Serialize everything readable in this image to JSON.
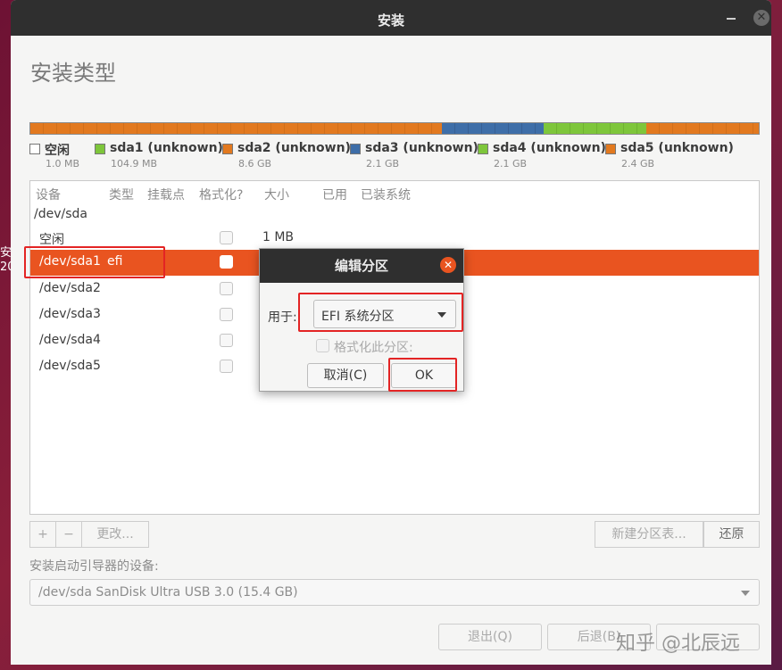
{
  "desktop": {
    "fragment_a": "安装",
    "fragment_b": "20"
  },
  "window": {
    "title": "安装"
  },
  "page": {
    "heading": "安装类型"
  },
  "partitions_bar": [
    {
      "name": "空闲",
      "size": "1.0 MB",
      "color": "#ffffff"
    },
    {
      "name": "sda1 (unknown)",
      "size": "104.9 MB",
      "color": "#7ec63b"
    },
    {
      "name": "sda2 (unknown)",
      "size": "8.6 GB",
      "color": "#e2791f"
    },
    {
      "name": "sda3 (unknown)",
      "size": "2.1 GB",
      "color": "#3e6ea8"
    },
    {
      "name": "sda4 (unknown)",
      "size": "2.1 GB",
      "color": "#7ec63b"
    },
    {
      "name": "sda5 (unknown)",
      "size": "2.4 GB",
      "color": "#e2791f"
    }
  ],
  "table": {
    "headers": [
      "设备",
      "类型",
      "挂载点",
      "格式化?",
      "大小",
      "已用",
      "已装系统"
    ],
    "rows": [
      {
        "device": "/dev/sda",
        "type": "",
        "size": ""
      },
      {
        "device": "空闲",
        "type": "",
        "size": "1 MB"
      },
      {
        "device": "/dev/sda1",
        "type": "efi",
        "size": ""
      },
      {
        "device": "/dev/sda2",
        "type": "",
        "size": ""
      },
      {
        "device": "/dev/sda3",
        "type": "",
        "size": ""
      },
      {
        "device": "/dev/sda4",
        "type": "",
        "size": ""
      },
      {
        "device": "/dev/sda5",
        "type": "",
        "size": ""
      }
    ]
  },
  "toolbar": {
    "add": "+",
    "remove": "−",
    "change": "更改...",
    "new_table": "新建分区表...",
    "revert": "还原"
  },
  "bootloader": {
    "label": "安装启动引导器的设备:",
    "value": "/dev/sda SanDisk Ultra USB 3.0 (15.4 GB)"
  },
  "footer": {
    "quit": "退出(Q)",
    "back": "后退(B)"
  },
  "watermark": "知乎 @北辰远",
  "dialog": {
    "title": "编辑分区",
    "use_as_label": "用于:",
    "use_as_value": "EFI 系统分区",
    "format_label": "格式化此分区:",
    "cancel": "取消(C)",
    "ok": "OK"
  },
  "colors": {
    "accent": "#e95420",
    "highlight": "#e32424",
    "titlebar": "#2f2f2f"
  }
}
